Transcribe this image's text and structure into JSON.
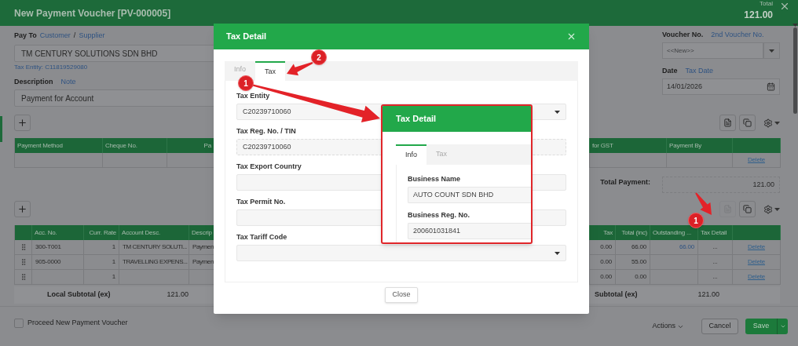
{
  "header": {
    "title": "New Payment Voucher [PV-000005]",
    "total_label": "Total",
    "total": "121.00"
  },
  "pay_to": {
    "label": "Pay To",
    "links": [
      "Customer",
      "Supplier"
    ],
    "separator": "/",
    "value": "TM CENTURY SOLUTIONS SDN BHD",
    "tax_entity": "Tax Entity: C11819529080"
  },
  "description": {
    "label": "Description",
    "link": "Note",
    "value": "Payment for Account"
  },
  "voucher_no": {
    "label": "Voucher No.",
    "link": "2nd Voucher No.",
    "placeholder": "<<New>>"
  },
  "date": {
    "label": "Date",
    "link": "Tax Date",
    "value": "14/01/2026"
  },
  "toolbars": [
    {
      "buttons": [
        {
          "disabled": false
        },
        {
          "disabled": false
        }
      ]
    },
    {
      "buttons": [
        {
          "disabled": true
        },
        {
          "disabled": false
        }
      ]
    }
  ],
  "payment_table": {
    "columns": [
      "Payment Method",
      "Cheque No.",
      "Pa",
      "for GST",
      "Payment By"
    ],
    "rows": [
      {
        "action": "Delete"
      }
    ]
  },
  "total_payment": {
    "label": "Total Payment:",
    "value": "121.00"
  },
  "detail_table": {
    "columns": [
      "Acc. No.",
      "Curr. Rate",
      "Account Desc.",
      "Descrip",
      "Tax",
      "Total (inc)",
      "Outstanding ...",
      "Tax Detail"
    ],
    "rows": [
      {
        "acc_no": "300-T001",
        "curr_rate": "1",
        "account_desc": "TM CENTURY SOLUTI...",
        "description": "Paymen",
        "tax": "0.00",
        "total_inc": "66.00",
        "outstanding": "66.00",
        "tax_detail": "...",
        "action": "Delete"
      },
      {
        "acc_no": "905-0000",
        "curr_rate": "1",
        "account_desc": "TRAVELLING EXPENS...",
        "description": "Paymen",
        "tax": "0.00",
        "total_inc": "55.00",
        "tax_detail": "...",
        "action": "Delete"
      },
      {
        "curr_rate": "1",
        "tax": "0.00",
        "total_inc": "0.00",
        "tax_detail": "...",
        "action": "Delete"
      }
    ]
  },
  "subtotals": {
    "local_label": "Local Subtotal (ex)",
    "local_value": "121.00",
    "label": "Subtotal (ex)",
    "value": "121.00"
  },
  "footer": {
    "proceed": {
      "label": "Proceed New Payment Voucher",
      "checked": false
    },
    "actions": "Actions",
    "cancel": "Cancel",
    "save": "Save"
  },
  "modal": {
    "title": "Tax Detail",
    "tabs": [
      {
        "label": "Info",
        "selected": false
      },
      {
        "label": "Tax",
        "selected": true
      }
    ],
    "fields": [
      {
        "label": "Tax Entity",
        "value": "C20239710060",
        "kind": "select"
      },
      {
        "label": "Tax Reg. No. / TIN",
        "value": "C20239710060",
        "kind": "readonly"
      },
      {
        "label": "Tax Export Country",
        "kind": "text"
      },
      {
        "label": "Tax Permit No.",
        "kind": "text"
      },
      {
        "label": "Tax Tariff Code",
        "kind": "select"
      }
    ],
    "close": "Close"
  },
  "callout": {
    "title": "Tax Detail",
    "tabs": [
      {
        "label": "Info",
        "selected": true
      },
      {
        "label": "Tax",
        "selected": false
      }
    ],
    "fields": [
      {
        "label": "Business Name",
        "value": "AUTO COUNT SDN BHD"
      },
      {
        "label": "Business Reg. No.",
        "value": "200601031841"
      }
    ]
  },
  "annotations": [
    {
      "label": "1"
    },
    {
      "label": "2"
    },
    {
      "label": "1"
    }
  ]
}
